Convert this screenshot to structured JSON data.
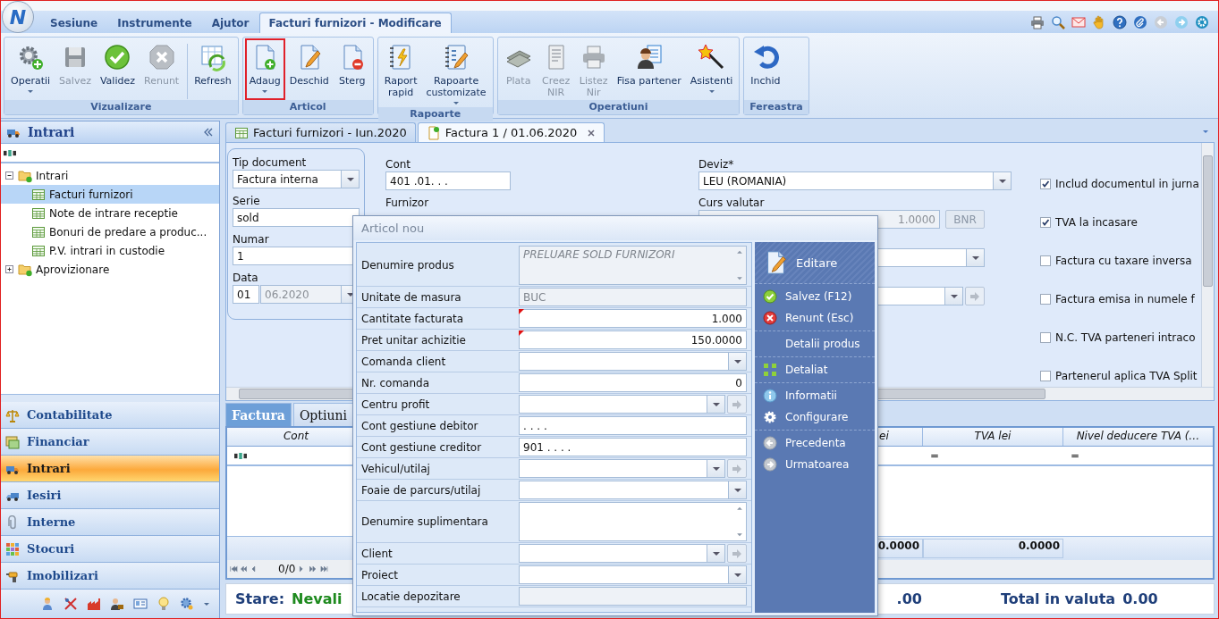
{
  "app_logo": "N",
  "menu": {
    "tabs": [
      {
        "label": "Sesiune",
        "selected": false
      },
      {
        "label": "Instrumente",
        "selected": false
      },
      {
        "label": "Ajutor",
        "selected": false
      },
      {
        "label": "Facturi furnizori - Modificare",
        "selected": true
      }
    ]
  },
  "ribbon": {
    "groups": [
      {
        "caption": "Vizualizare",
        "buttons": [
          {
            "label": "Operatii",
            "disabled": false,
            "dropdown": true,
            "highlighted": false,
            "separator_before": false
          },
          {
            "label": "Salvez",
            "disabled": true,
            "dropdown": false,
            "highlighted": false,
            "separator_before": false
          },
          {
            "label": "Validez",
            "disabled": false,
            "dropdown": false,
            "highlighted": false,
            "separator_before": false
          },
          {
            "label": "Renunt",
            "disabled": true,
            "dropdown": false,
            "highlighted": false,
            "separator_before": false
          },
          {
            "label": "Refresh",
            "disabled": false,
            "dropdown": false,
            "highlighted": false,
            "separator_before": true
          }
        ]
      },
      {
        "caption": "Articol",
        "buttons": [
          {
            "label": "Adaug",
            "disabled": false,
            "dropdown": true,
            "highlighted": true,
            "separator_before": false
          },
          {
            "label": "Deschid",
            "disabled": false,
            "dropdown": false,
            "highlighted": false,
            "separator_before": false
          },
          {
            "label": "Sterg",
            "disabled": false,
            "dropdown": false,
            "highlighted": false,
            "separator_before": false
          }
        ]
      },
      {
        "caption": "Rapoarte",
        "buttons": [
          {
            "label": "Raport\nrapid",
            "disabled": false,
            "dropdown": false,
            "highlighted": false,
            "separator_before": false
          },
          {
            "label": "Rapoarte\ncustomizate",
            "disabled": false,
            "dropdown": true,
            "highlighted": false,
            "separator_before": false
          }
        ]
      },
      {
        "caption": "Operatiuni",
        "buttons": [
          {
            "label": "Plata",
            "disabled": true,
            "dropdown": false,
            "highlighted": false,
            "separator_before": false
          },
          {
            "label": "Creez\nNIR",
            "disabled": true,
            "dropdown": false,
            "highlighted": false,
            "separator_before": false
          },
          {
            "label": "Listez\nNir",
            "disabled": true,
            "dropdown": false,
            "highlighted": false,
            "separator_before": false
          },
          {
            "label": "Fisa partener",
            "disabled": false,
            "dropdown": false,
            "highlighted": false,
            "separator_before": false
          },
          {
            "label": "Asistenti",
            "disabled": false,
            "dropdown": true,
            "highlighted": false,
            "separator_before": false
          }
        ]
      },
      {
        "caption": "Fereastra",
        "buttons": [
          {
            "label": "Inchid",
            "disabled": false,
            "dropdown": false,
            "highlighted": false,
            "separator_before": false
          }
        ]
      }
    ]
  },
  "sidebar": {
    "title": "Intrari",
    "tree": [
      {
        "label": "Intrari",
        "expanded": true,
        "selected": false,
        "children": [
          {
            "label": "Facturi furnizori",
            "selected": true
          },
          {
            "label": "Note de intrare receptie",
            "selected": false
          },
          {
            "label": "Bonuri de predare a produc...",
            "selected": false
          },
          {
            "label": "P.V. intrari in custodie",
            "selected": false
          }
        ]
      },
      {
        "label": "Aprovizionare",
        "expanded": false,
        "selected": false
      }
    ],
    "nav": [
      {
        "label": "Contabilitate",
        "selected": false
      },
      {
        "label": "Financiar",
        "selected": false
      },
      {
        "label": "Intrari",
        "selected": true
      },
      {
        "label": "Iesiri",
        "selected": false
      },
      {
        "label": "Interne",
        "selected": false
      },
      {
        "label": "Stocuri",
        "selected": false
      },
      {
        "label": "Imobilizari",
        "selected": false
      }
    ]
  },
  "doc_tabs": [
    {
      "label": "Facturi furnizori - Iun.2020",
      "selected": false,
      "closable": false
    },
    {
      "label": "Factura 1 / 01.06.2020",
      "selected": true,
      "closable": true
    }
  ],
  "document": {
    "fields": [
      {
        "label": "Tip document",
        "kind": "combo",
        "value": "Factura interna"
      },
      {
        "label": "Serie",
        "kind": "text",
        "value": "sold"
      },
      {
        "label": "Numar",
        "kind": "text",
        "value": "1"
      },
      {
        "label": "Data",
        "kind": "date",
        "day": "01",
        "value": "06.2020"
      }
    ],
    "cont": {
      "label": "Cont",
      "value": "401 .01. . . "
    },
    "furnizor_label": "Furnizor",
    "deviz": {
      "label": "Deviz*",
      "value": "LEU (ROMANIA)"
    },
    "curs": {
      "label": "Curs valutar",
      "value": "1.0000",
      "button": "BNR"
    },
    "extra_fields": [
      {
        "kind": "combo"
      },
      {
        "kind": "combo-link"
      }
    ],
    "options": [
      {
        "label": "Includ documentul in jurna",
        "checked": true
      },
      {
        "label": "TVA la incasare",
        "checked": true
      },
      {
        "label": "Factura cu taxare inversa",
        "checked": false
      },
      {
        "label": "Factura emisa in numele f",
        "checked": false
      },
      {
        "label": "N.C. TVA parteneri intraco",
        "checked": false
      },
      {
        "label": "Partenerul aplica TVA Split",
        "checked": false
      }
    ]
  },
  "inner_tabs": [
    {
      "label": "Factura",
      "selected": true
    },
    {
      "label": "Optiuni",
      "selected": false
    }
  ],
  "grid": {
    "columns": [
      {
        "label": "Cont",
        "kind": "text"
      },
      {
        "label": "ei",
        "kind": "number"
      },
      {
        "label": "TVA lei",
        "kind": "number",
        "filter": "="
      },
      {
        "label": "Nivel deducere TVA (…",
        "kind": "number",
        "filter": "="
      }
    ],
    "summary": [
      "0.0000",
      "0.0000"
    ],
    "pager": "0/0"
  },
  "status": {
    "label": "Stare:",
    "value": "Nevali",
    "total_fragment": ".00",
    "total_label": "Total in valuta",
    "total_value": "0.00"
  },
  "dialog": {
    "title": "Articol nou",
    "fields": [
      {
        "label": "Denumire produs",
        "kind": "memo",
        "value": "PRELUARE SOLD FURNIZORI",
        "readonly": true,
        "required": false
      },
      {
        "label": "Unitate de masura",
        "kind": "text",
        "value": "BUC",
        "readonly": true,
        "required": false
      },
      {
        "label": "Cantitate facturata",
        "kind": "number",
        "value": "1.000",
        "readonly": false,
        "required": true
      },
      {
        "label": "Pret unitar achizitie",
        "kind": "number",
        "value": "150.0000",
        "readonly": false,
        "required": true
      },
      {
        "label": "Comanda client",
        "kind": "combo",
        "readonly": false,
        "required": false
      },
      {
        "label": "Nr. comanda",
        "kind": "number",
        "value": "0",
        "readonly": false,
        "required": false
      },
      {
        "label": "Centru profit",
        "kind": "combo-link",
        "readonly": false,
        "required": false
      },
      {
        "label": "Cont gestiune debitor",
        "kind": "text",
        "value": "  . . . .",
        "readonly": false,
        "required": false
      },
      {
        "label": "Cont gestiune creditor",
        "kind": "text",
        "value": "901 . . . .",
        "readonly": false,
        "required": false
      },
      {
        "label": "Vehicul/utilaj",
        "kind": "combo-link",
        "readonly": false,
        "required": false
      },
      {
        "label": "Foaie de parcurs/utilaj",
        "kind": "combo",
        "readonly": false,
        "required": false
      },
      {
        "label": "Denumire suplimentara",
        "kind": "memo",
        "readonly": false,
        "required": false
      },
      {
        "label": "Client",
        "kind": "combo-link",
        "readonly": false,
        "required": false
      },
      {
        "label": "Proiect",
        "kind": "combo",
        "readonly": false,
        "required": false
      },
      {
        "label": "Locatie depozitare",
        "kind": "text",
        "readonly": true,
        "required": false
      }
    ],
    "panel_title": "Editare",
    "action_groups": [
      {
        "items": [
          "Salvez (F12)",
          "Renunt (Esc)"
        ]
      },
      {
        "items": [
          "Detalii produs"
        ]
      },
      {
        "items": [
          "Detaliat"
        ]
      },
      {
        "items": [
          "Informatii",
          "Configurare"
        ]
      },
      {
        "items": [
          "Precedenta",
          "Urmatoarea"
        ]
      }
    ]
  }
}
